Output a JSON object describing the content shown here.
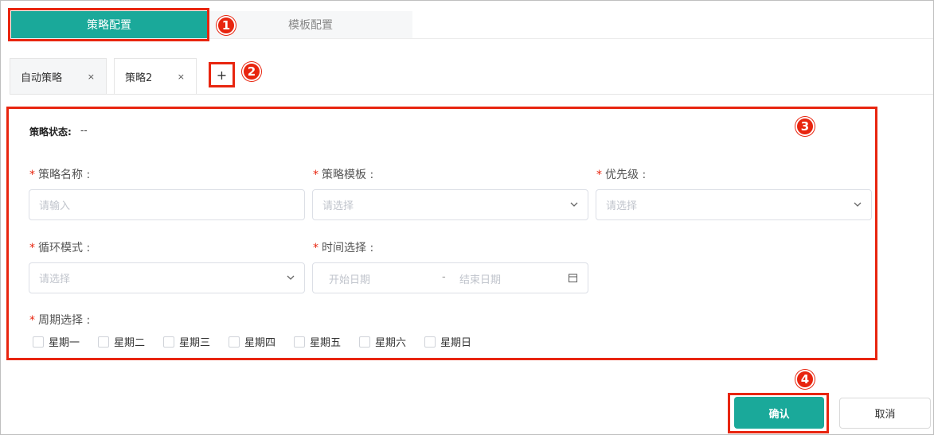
{
  "top_tabs": [
    {
      "label": "策略配置",
      "active": true
    },
    {
      "label": "模板配置",
      "active": false
    }
  ],
  "strategy_tabs": [
    {
      "label": "自动策略",
      "close": "×"
    },
    {
      "label": "策略2",
      "close": "×"
    }
  ],
  "add_tab": "+",
  "annotations": [
    "1",
    "2",
    "3",
    "4"
  ],
  "form": {
    "status_label": "策略状态:",
    "status_value": "--",
    "required_mark": "*",
    "name": {
      "label": "策略名称 :",
      "placeholder": "请输入"
    },
    "template": {
      "label": "策略模板 :",
      "placeholder": "请选择"
    },
    "priority": {
      "label": "优先级 :",
      "placeholder": "请选择"
    },
    "cycle": {
      "label": "循环模式 :",
      "placeholder": "请选择"
    },
    "time": {
      "label": "时间选择 :",
      "start_placeholder": "开始日期",
      "separator": "-",
      "end_placeholder": "结束日期"
    },
    "weekdays": {
      "label": "周期选择 :",
      "days": [
        "星期一",
        "星期二",
        "星期三",
        "星期四",
        "星期五",
        "星期六",
        "星期日"
      ]
    }
  },
  "buttons": {
    "confirm": "确认",
    "cancel": "取消"
  },
  "colors": {
    "primary": "#1aa99a",
    "annotation": "#e8250f"
  }
}
